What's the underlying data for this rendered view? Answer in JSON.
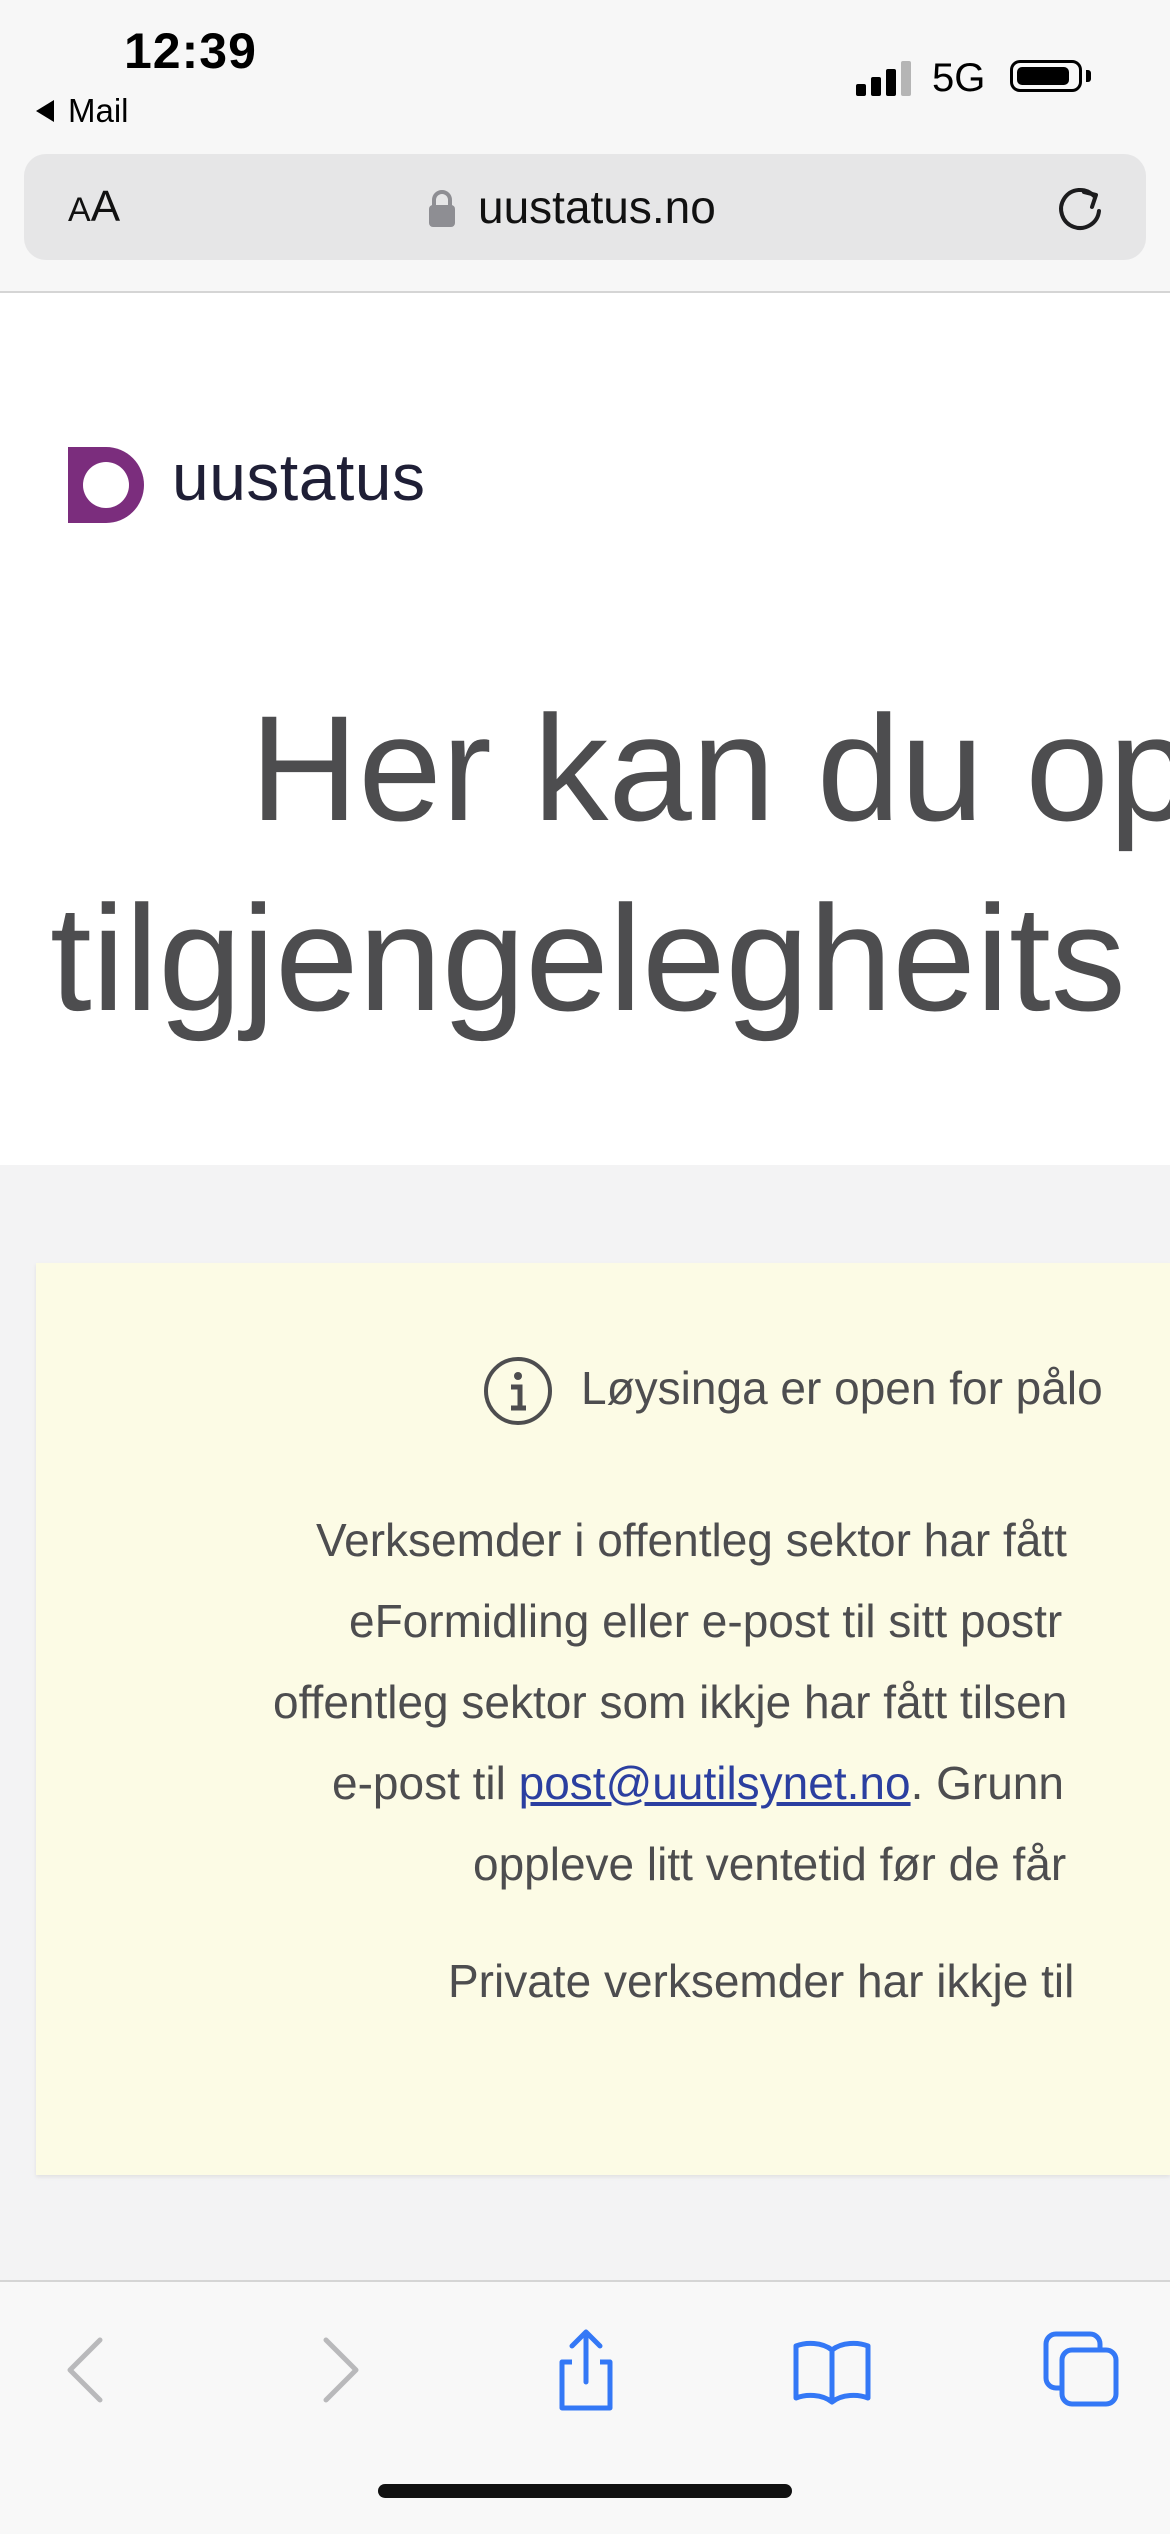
{
  "status_bar": {
    "time": "12:39",
    "back_app": "Mail",
    "network": "5G"
  },
  "address_bar": {
    "text_size_small": "A",
    "text_size_large": "A",
    "url": "uustatus.no"
  },
  "site": {
    "logo_text": "uustatus",
    "hero_line1": "Her kan du op",
    "hero_line2": "tilgjengelegheits"
  },
  "notice": {
    "headline": "Løysinga er open for pålo",
    "para1_line1": "Verksemder i offentleg sektor har fått",
    "para1_line2": "eFormidling eller e-post til sitt postr",
    "para1_line3": "offentleg sektor som ikkje har fått tilsen",
    "para1_line4_prefix": "e-post til ",
    "para1_line4_email": "post@uutilsynet.no",
    "para1_line4_suffix": ". Grunn",
    "para1_line5": "oppleve litt ventetid før de får",
    "para2": "Private verksemder har ikkje til"
  },
  "colors": {
    "brand_purple": "#7b2d7d",
    "link_blue": "#2b3fa0",
    "toolbar_blue": "#3478f6",
    "notice_background": "#fcfbe5"
  }
}
